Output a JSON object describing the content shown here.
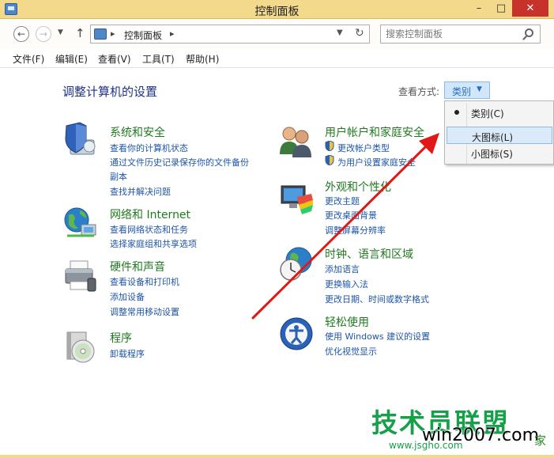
{
  "window": {
    "title": "控制面板",
    "controls": {
      "minimize": "–",
      "maximize": "□",
      "close": "✕"
    }
  },
  "address_bar": {
    "breadcrumb": [
      "控制面板"
    ],
    "search_placeholder": "搜索控制面板"
  },
  "menu": [
    "文件(F)",
    "编辑(E)",
    "查看(V)",
    "工具(T)",
    "帮助(H)"
  ],
  "page": {
    "title": "调整计算机的设置",
    "view_by_label": "查看方式:",
    "view_by_value": "类别"
  },
  "categories": [
    {
      "title": "系统和安全",
      "icon": "shield-computer-icon",
      "links": [
        "查看你的计算机状态",
        "通过文件历史记录保存你的文件备份",
        "副本",
        "查找并解决问题"
      ]
    },
    {
      "title": "网络和 Internet",
      "icon": "network-globe-icon",
      "links": [
        "查看网络状态和任务",
        "选择家庭组和共享选项"
      ]
    },
    {
      "title": "硬件和声音",
      "icon": "printer-icon",
      "links": [
        "查看设备和打印机",
        "添加设备",
        "调整常用移动设置"
      ]
    },
    {
      "title": "程序",
      "icon": "programs-disc-icon",
      "links": [
        "卸载程序"
      ]
    },
    {
      "title": "用户帐户和家庭安全",
      "icon": "user-accounts-icon",
      "links": [
        "更改帐户类型",
        "为用户设置家庭安全"
      ]
    },
    {
      "title": "外观和个性化",
      "icon": "appearance-monitor-icon",
      "links": [
        "更改主题",
        "更改桌面背景",
        "调整屏幕分辨率"
      ]
    },
    {
      "title": "时钟、语言和区域",
      "icon": "clock-globe-icon",
      "links": [
        "添加语言",
        "更换输入法",
        "更改日期、时间或数字格式"
      ]
    },
    {
      "title": "轻松使用",
      "icon": "ease-of-access-icon",
      "links": [
        "使用 Windows 建议的设置",
        "优化视觉显示"
      ]
    }
  ],
  "view_dropdown": {
    "items": [
      "类别(C)",
      "大图标(L)",
      "小图标(S)"
    ],
    "selected_index": 0,
    "hover_index": 1
  },
  "watermark": {
    "main": "技术员联盟",
    "sub": "win2007.com",
    "tail": "家",
    "url": "www.jsgho.com"
  },
  "colors": {
    "titlebar": "#f2d98c",
    "category_title": "#1f7a1f",
    "link": "#1e55a8",
    "page_title": "#1e3287",
    "arrow": "#e01818",
    "watermark": "#16a04a"
  }
}
